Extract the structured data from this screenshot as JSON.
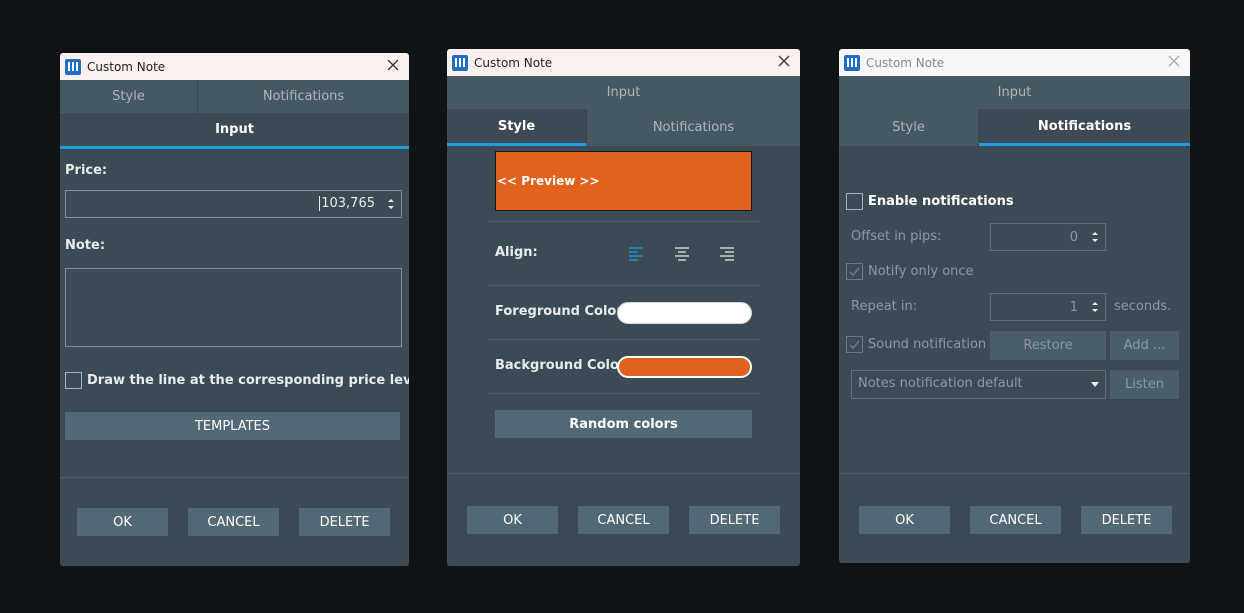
{
  "windows": [
    {
      "title": "Custom Note",
      "tabs_top": [
        "Style",
        "Notifications"
      ],
      "tab_active": "Input",
      "price_label": "Price:",
      "price_value": "103,765",
      "note_label": "Note:",
      "note_value": "",
      "draw_line_label": "Draw the line at the corresponding price level",
      "draw_line_checked": false,
      "templates_label": "TEMPLATES",
      "ok_label": "OK",
      "cancel_label": "CANCEL",
      "delete_label": "DELETE"
    },
    {
      "title": "Custom Note",
      "tab_input": "Input",
      "tabs": [
        "Style",
        "Notifications"
      ],
      "active_tab": "Style",
      "preview_text": "<< Preview >>",
      "align_label": "Align:",
      "align_selected": "left",
      "foreground_label": "Foreground Color:",
      "foreground_color": "#ffffff",
      "background_label": "Background Color:",
      "background_color": "#e0621d",
      "random_label": "Random colors",
      "ok_label": "OK",
      "cancel_label": "CANCEL",
      "delete_label": "DELETE"
    },
    {
      "title": "Custom Note",
      "tab_input": "Input",
      "tabs": [
        "Style",
        "Notifications"
      ],
      "active_tab": "Notifications",
      "enable_label": "Enable notifications",
      "enable_checked": false,
      "offset_label": "Offset in pips:",
      "offset_value": "0",
      "notify_once_label": "Notify only once",
      "notify_once_checked": true,
      "repeat_label": "Repeat in:",
      "repeat_value": "1",
      "seconds_label": "seconds.",
      "sound_label": "Sound notification",
      "sound_checked": true,
      "restore_label": "Restore",
      "add_label": "Add ...",
      "sound_select": "Notes notification default",
      "listen_label": "Listen",
      "ok_label": "OK",
      "cancel_label": "CANCEL",
      "delete_label": "DELETE"
    }
  ],
  "colors": {
    "accent": "#1e9fe2",
    "window_bg": "#3b4a55",
    "button_bg": "#526874",
    "preview_bg": "#e0621d"
  }
}
